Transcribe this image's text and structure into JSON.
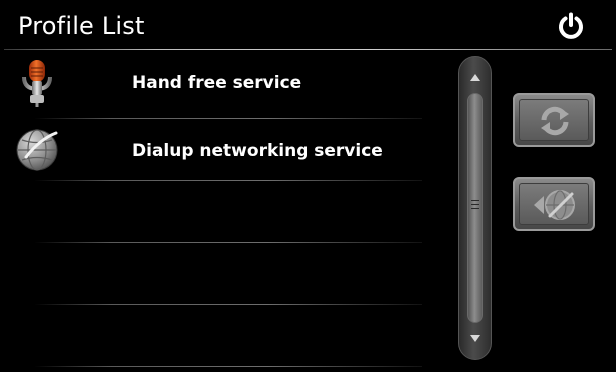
{
  "header": {
    "title": "Profile List",
    "power_icon": "power-icon"
  },
  "profiles": [
    {
      "label": "Hand free service",
      "icon": "microphone-icon"
    },
    {
      "label": "Dialup networking service",
      "icon": "globe-icon"
    }
  ],
  "empty_rows": 3,
  "scrollbar": {
    "up_icon": "arrow-up-icon",
    "down_icon": "arrow-down-icon"
  },
  "side_buttons": [
    {
      "name": "refresh",
      "icon": "refresh-icon"
    },
    {
      "name": "disconnect",
      "icon": "disconnect-icon"
    }
  ],
  "colors": {
    "background": "#000000",
    "text": "#ffffff",
    "button_grey": "#6e6e6e",
    "mic_accent": "#e2561e"
  }
}
